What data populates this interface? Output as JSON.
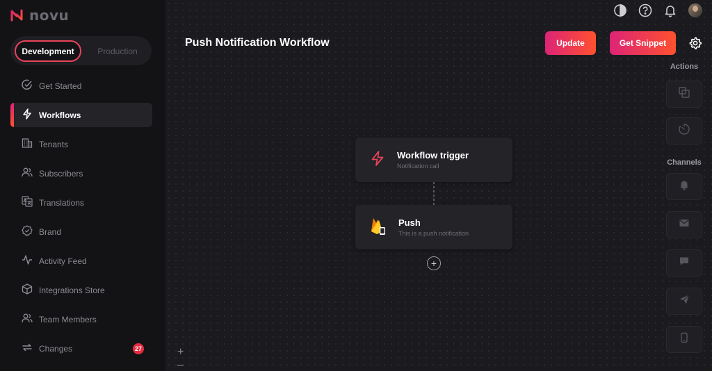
{
  "brand": {
    "name": "novu"
  },
  "environment": {
    "development": "Development",
    "production": "Production"
  },
  "nav": [
    {
      "label": "Get Started",
      "icon": "check-circle-icon"
    },
    {
      "label": "Workflows",
      "icon": "bolt-icon"
    },
    {
      "label": "Tenants",
      "icon": "building-icon"
    },
    {
      "label": "Subscribers",
      "icon": "users-icon"
    },
    {
      "label": "Translations",
      "icon": "translate-icon"
    },
    {
      "label": "Brand",
      "icon": "badge-check-icon"
    },
    {
      "label": "Activity Feed",
      "icon": "activity-icon"
    },
    {
      "label": "Integrations Store",
      "icon": "box-icon"
    },
    {
      "label": "Team Members",
      "icon": "team-icon"
    },
    {
      "label": "Changes",
      "icon": "sync-icon",
      "badge": "27"
    }
  ],
  "header": {
    "title": "Push Notification Workflow",
    "update_label": "Update",
    "snippet_label": "Get Snippet"
  },
  "right_panel": {
    "actions_title": "Actions",
    "channels_title": "Channels"
  },
  "nodes": {
    "trigger": {
      "title": "Workflow trigger",
      "subtitle": "Notification call"
    },
    "push": {
      "title": "Push",
      "subtitle": "This is a push notification"
    }
  },
  "canvas": {
    "add_symbol": "+",
    "zoom_in": "+",
    "zoom_out": "–"
  },
  "colors": {
    "accent_start": "#dd2476",
    "accent_end": "#ff512f",
    "badge": "#e52c3f"
  }
}
